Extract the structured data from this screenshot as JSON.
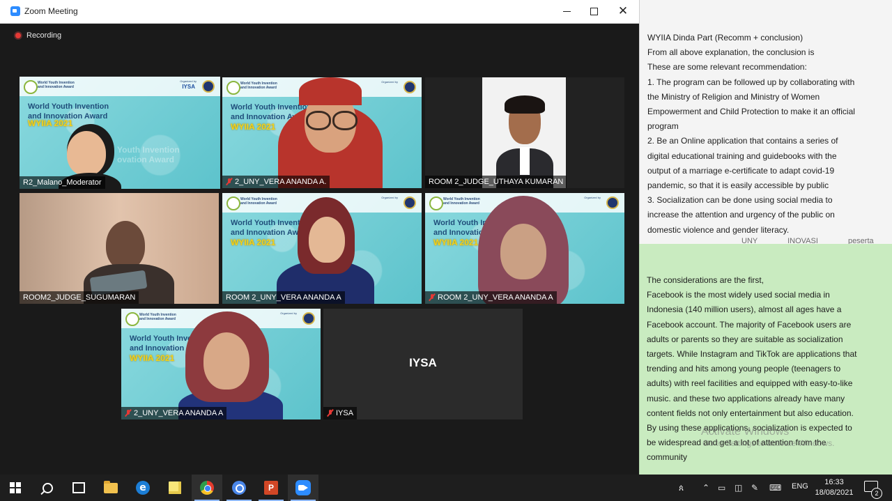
{
  "window": {
    "title": "Zoom Meeting",
    "minimize_label": "",
    "maximize_label": "",
    "close_label": "✕"
  },
  "recording": {
    "label": "Recording"
  },
  "banner": {
    "logo_text": "World Youth Invention and Innovation Award",
    "organized_by": "Organized by",
    "org_logo": "IYSA",
    "title_line1": "World Youth Invention",
    "title_line2": "and Innovation Award",
    "year": "WYIIA 2021",
    "watermark_line1": "Youth Invention",
    "watermark_line2": "ovation Award"
  },
  "participants": [
    {
      "name": "R2_Malano_Moderator",
      "muted": false,
      "active": true
    },
    {
      "name": "2_UNY_VERA ANANDA A.",
      "muted": true,
      "active": false
    },
    {
      "name": "ROOM 2_JUDGE_UTHAYA KUMARAN",
      "muted": false,
      "active": false
    },
    {
      "name": "ROOM2_JUDGE_SUGUMARAN",
      "muted": false,
      "active": false
    },
    {
      "name": "ROOM 2_UNY_VERA ANANDA A",
      "muted": false,
      "active": false
    },
    {
      "name": "ROOM 2_UNY_VERA ANANDA A",
      "muted": true,
      "active": false
    },
    {
      "name": "2_UNY_VERA ANANDA A",
      "muted": true,
      "active": false
    },
    {
      "name": "IYSA",
      "muted": true,
      "active": false,
      "placeholder": "IYSA"
    }
  ],
  "notes_top": {
    "lines": [
      "WYIIA Dinda Part (Recomm + conclusion)",
      "From all above explanation, the conclusion is",
      "These are some relevant recommendation:",
      "1. The program can be followed up by collaborating with",
      "the Ministry of Religion and Ministry of Women",
      "Empowerment and Child Protection to make it an official",
      "program",
      "2. Be an Online application that contains a series of",
      "digital educational training and guidebooks with the",
      "output of a marriage e-certificate to adapt covid-19",
      "pandemic, so that it is easily accessible by public",
      "3. Socialization can be done using social media to",
      "increase the attention and urgency of the public on",
      "domestic violence and gender literacy."
    ]
  },
  "faint_row": "UNY INOVASI peserta WYIIA",
  "notes_bottom": {
    "lines": [
      "The considerations are the first,",
      "Facebook is the most widely used social media in",
      "Indonesia (140 million users), almost all ages have a",
      "Facebook account. The majority of Facebook users are",
      "adults or parents so they are suitable as socialization",
      "targets. While Instagram and TikTok are applications that",
      "trending and hits among young people (teenagers to",
      "adults) with reel facilities and equipped with easy-to-like",
      "music. and these two applications already have many",
      "content fields not only entertainment but also education.",
      "By using these applications, socialization is expected to",
      "be widespread and get a lot of attention from the",
      "community"
    ]
  },
  "activation_watermark": {
    "title": "Activate Windows",
    "subtitle": "Go to Settings to activate Windows."
  },
  "taskbar": {
    "ppt_letter": "P",
    "edge_letter": "e",
    "language": "ENG",
    "time": "16:33",
    "date": "18/08/2021",
    "notification_count": "2"
  },
  "colors": {
    "active_speaker": "#d8f06a",
    "muted_mic": "#e53935",
    "notes_green": "#c9ebc0",
    "zoom_blue": "#2d8cff"
  }
}
